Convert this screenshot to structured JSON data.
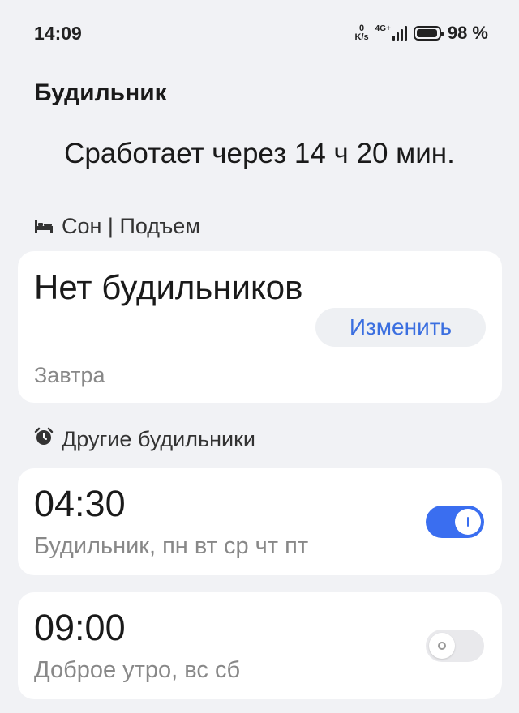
{
  "status_bar": {
    "time": "14:09",
    "net_speed_value": "0",
    "net_speed_unit": "K/s",
    "network_type": "4G+",
    "battery_percent_label": "98 %",
    "battery_level": 0.98,
    "signal_bars": 4,
    "icons": [
      "network-speed-icon",
      "signal-icon",
      "battery-icon"
    ]
  },
  "header": {
    "title": "Будильник",
    "countdown": "Сработает через 14 ч 20 мин."
  },
  "sleep_section": {
    "label": "Сон | Подъем",
    "icon": "bed-icon",
    "card": {
      "title": "Нет будильников",
      "subtitle": "Завтра",
      "edit_label": "Изменить"
    }
  },
  "other_section": {
    "label": "Другие будильники",
    "icon": "alarm-clock-icon",
    "alarms": [
      {
        "time": "04:30",
        "description": "Будильник, пн вт ср чт пт",
        "enabled": true
      },
      {
        "time": "09:00",
        "description": "Доброе утро, вс сб",
        "enabled": false
      }
    ]
  },
  "colors": {
    "background": "#f1f2f5",
    "card": "#ffffff",
    "accent": "#3a6ef0",
    "link": "#3b6fe0",
    "secondary_text": "#888888"
  }
}
